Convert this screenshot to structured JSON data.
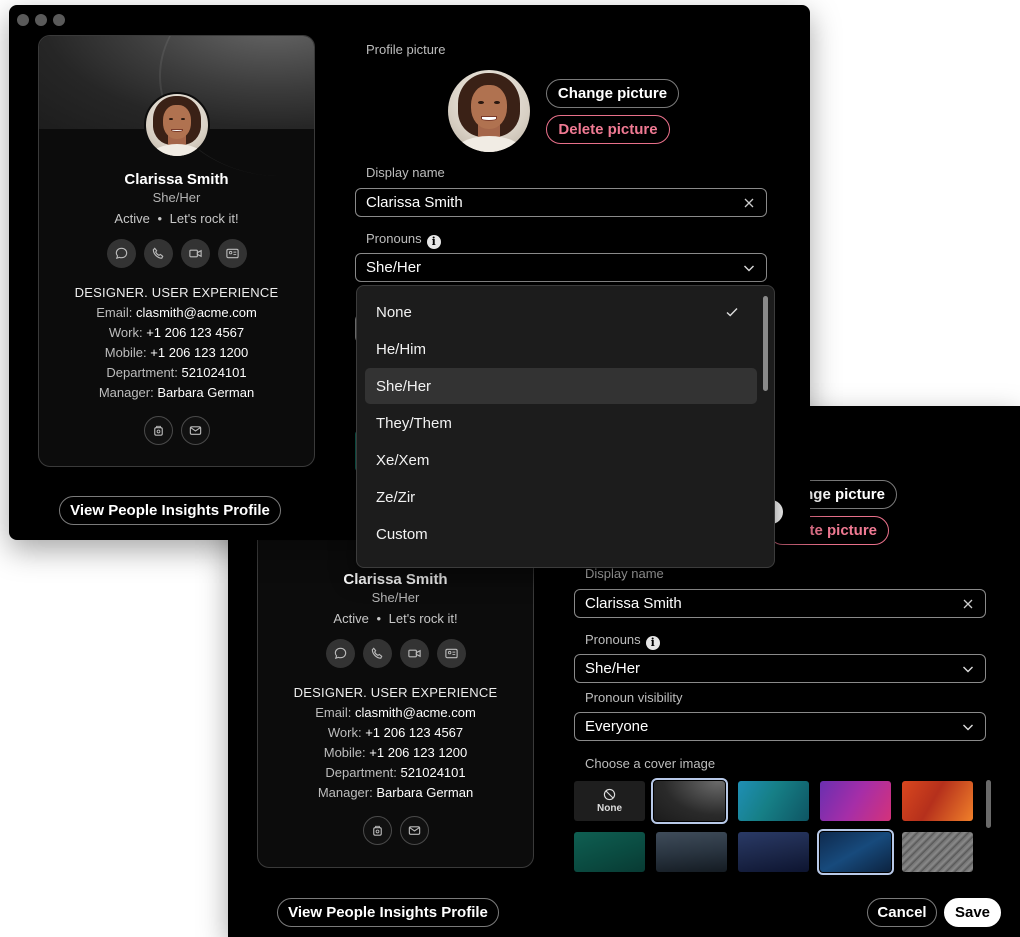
{
  "profile": {
    "name": "Clarissa Smith",
    "pronouns": "She/Her",
    "status": "Active",
    "status_separator": "•",
    "status_message": "Let's rock it!",
    "job_title": "DESIGNER. USER EXPERIENCE",
    "email_label": "Email:",
    "email": "clasmith@acme.com",
    "work_label": "Work:",
    "work": "+1 206 123 4567",
    "mobile_label": "Mobile:",
    "mobile": "+1 206 123 1200",
    "department_label": "Department:",
    "department": "521024101",
    "manager_label": "Manager:",
    "manager": "Barbara German",
    "insights_button": "View People Insights Profile"
  },
  "form": {
    "profile_picture_label": "Profile picture",
    "change_picture": "Change picture",
    "delete_picture": "Delete picture",
    "display_name_label": "Display name",
    "display_name_value": "Clarissa Smith",
    "pronouns_label": "Pronouns",
    "pronouns_value": "She/Her",
    "pronoun_visibility_label": "Pronoun visibility",
    "pronoun_visibility_value": "Everyone",
    "cover_image_label": "Choose a cover image",
    "cover_none_label": "None",
    "cancel": "Cancel",
    "save": "Save"
  },
  "back_window": {
    "change_picture_partial": "nge picture",
    "delete_picture_partial": "te picture"
  },
  "pronoun_options": [
    "None",
    "He/Him",
    "She/Her",
    "They/Them",
    "Xe/Xem",
    "Ze/Zir",
    "Custom"
  ],
  "pronoun_checked": "None",
  "pronoun_highlighted": "She/Her",
  "colors": {
    "background": "#000000",
    "danger": "#f07a93",
    "selected_outline": "#b8c9e8"
  }
}
